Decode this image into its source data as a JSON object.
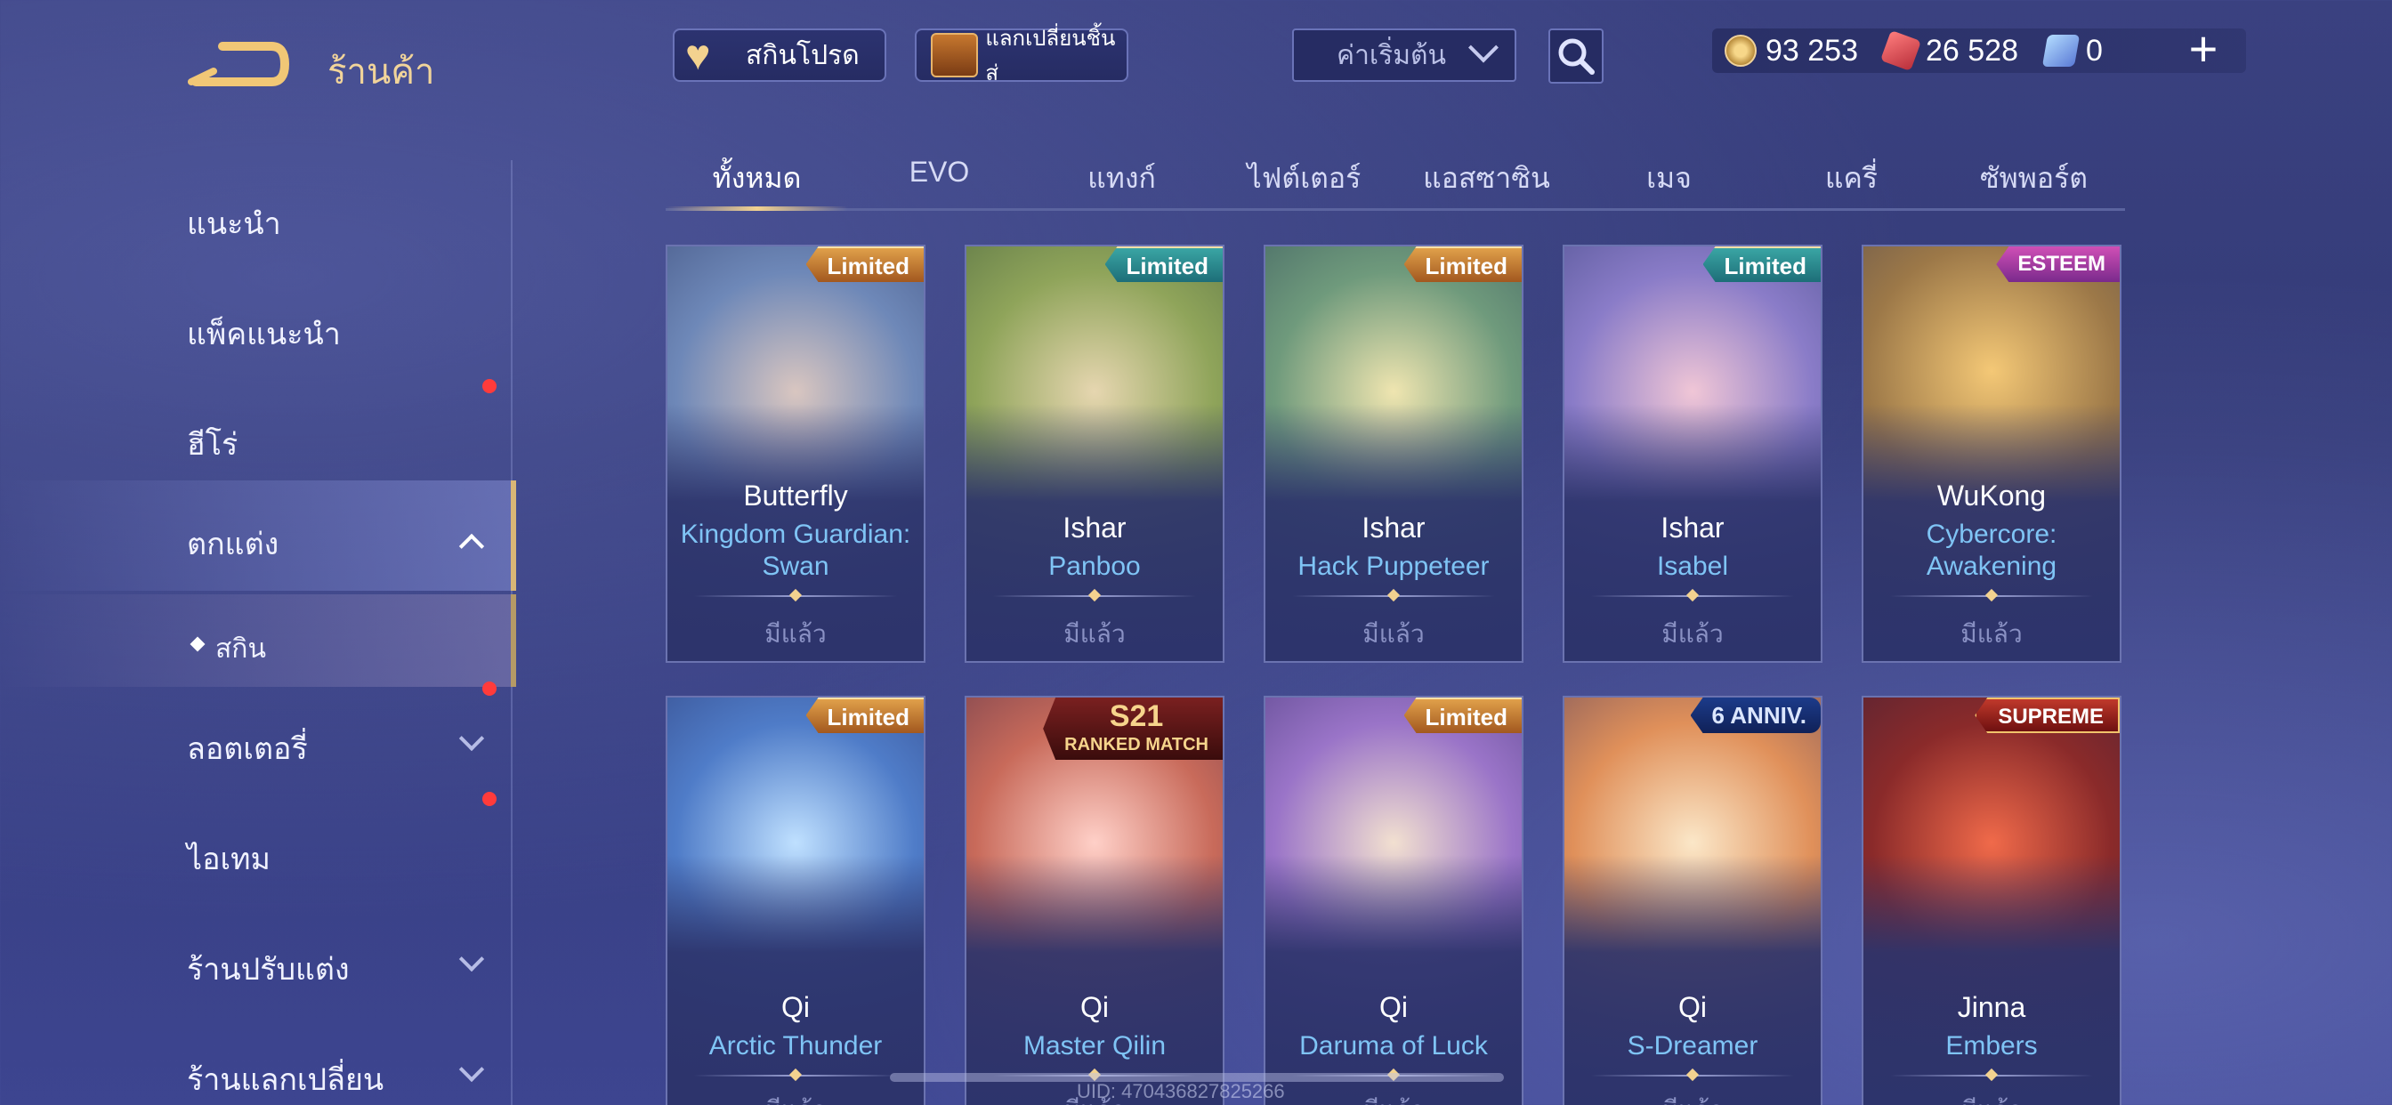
{
  "header": {
    "title": "ร้านค้า",
    "favorites_label": "สกินโปรด",
    "exchange_label": "แลกเปลี่ยนชิ้นส่",
    "sort_value": "ค่าเริ่มต้น"
  },
  "currency": {
    "gold": "93 253",
    "vouchers": "26 528",
    "diamonds": "0"
  },
  "sidebar": {
    "items": [
      {
        "label": "แนะนำ"
      },
      {
        "label": "แพ็คแนะนำ"
      },
      {
        "label": "ฮีโร่"
      },
      {
        "label": "ตกแต่ง"
      },
      {
        "label": "สกิน"
      },
      {
        "label": "ลอตเตอรี่"
      },
      {
        "label": "ไอเทม"
      },
      {
        "label": "ร้านปรับแต่ง"
      },
      {
        "label": "ร้านแลกเปลี่ยน"
      }
    ]
  },
  "tabs": [
    "ทั้งหมด",
    "EVO",
    "แทงก์",
    "ไฟต์เตอร์",
    "แอสซาซิน",
    "เมจ",
    "แครี่",
    "ซัพพอร์ต"
  ],
  "cards": [
    {
      "hero": "Butterfly",
      "skin": "Kingdom Guardian: Swan",
      "badge": "Limited",
      "status": "มีแล้ว",
      "art_color": "#3f5f8f"
    },
    {
      "hero": "Ishar",
      "skin": "Panboo",
      "badge": "Limited",
      "status": "มีแล้ว",
      "art_color": "#7a8a3a"
    },
    {
      "hero": "Ishar",
      "skin": "Hack Puppeteer",
      "badge": "Limited",
      "status": "มีแล้ว",
      "art_color": "#4f7c6a"
    },
    {
      "hero": "Ishar",
      "skin": "Isabel",
      "badge": "Limited",
      "status": "มีแล้ว",
      "art_color": "#5a6fb8"
    },
    {
      "hero": "WuKong",
      "skin": "Cybercore: Awakening",
      "badge": "ESTEEM",
      "status": "มีแล้ว",
      "art_color": "#8a6a3a"
    },
    {
      "hero": "Qi",
      "skin": "Arctic Thunder",
      "badge": "Limited",
      "status": "มีแล้ว",
      "art_color": "#3a6aa8"
    },
    {
      "hero": "Qi",
      "skin": "Master Qilin",
      "badge_line1": "S21",
      "badge_line2": "RANKED MATCH",
      "status": "มีแล้ว",
      "art_color": "#a8504a"
    },
    {
      "hero": "Qi",
      "skin": "Daruma of Luck",
      "badge": "Limited",
      "status": "มีแล้ว",
      "art_color": "#7a5aa8"
    },
    {
      "hero": "Qi",
      "skin": "S-Dreamer",
      "badge": "6 ANNIV.",
      "status": "มีแล้ว",
      "art_color": "#c87a4a"
    },
    {
      "hero": "Jinna",
      "skin": "Embers",
      "badge": "SUPREME",
      "status": "มีแล้ว",
      "art_color": "#8a2a2a"
    }
  ],
  "footer": {
    "uid": "UID: 470436827825266"
  }
}
